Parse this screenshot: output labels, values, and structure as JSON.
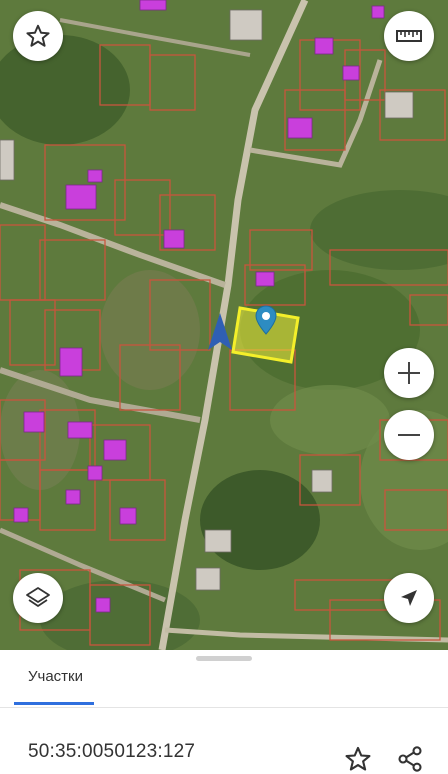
{
  "map": {
    "controls": {
      "favorite_icon": "star-outline",
      "ruler_icon": "ruler",
      "zoom_in_icon": "plus",
      "zoom_out_icon": "minus",
      "layers_icon": "layers",
      "locate_icon": "navigation-arrow"
    },
    "colors": {
      "parcel_outline": "#c8553d",
      "building_highlight": "#c93fdc",
      "selected_parcel": "#f2ee3a",
      "marker": "#2d8cc2",
      "direction_arrow": "#2f5fb4"
    }
  },
  "bottom_sheet": {
    "tab_label": "Участки",
    "cadastral_number": "50:35:0050123:127",
    "accent_color": "#2f6fde",
    "actions": [
      "star-icon",
      "share-icon"
    ]
  }
}
